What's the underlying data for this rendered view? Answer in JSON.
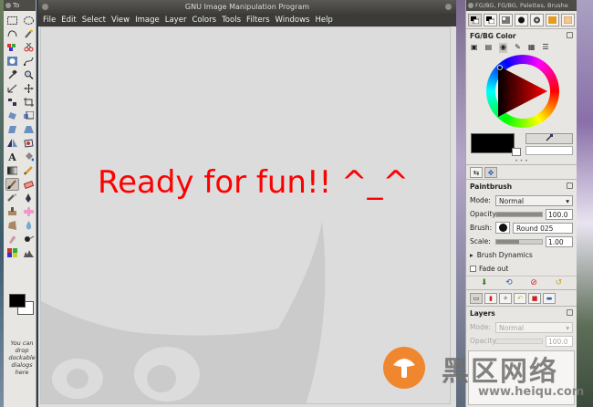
{
  "toolbox": {
    "title": "To",
    "drop_hint": "You can drop dockable dialogs here"
  },
  "main_window": {
    "title": "GNU Image Manipulation Program",
    "menu": [
      "File",
      "Edit",
      "Select",
      "View",
      "Image",
      "Layer",
      "Colors",
      "Tools",
      "Filters",
      "Windows",
      "Help"
    ],
    "canvas_text": "Ready for fun!! ^_^",
    "canvas_text_color": "#ff0000"
  },
  "dock": {
    "title": "FG/BG, FG/BG, Palettes, Brushe",
    "fgbg": {
      "title": "FG/BG Color",
      "fg_color": "#000000",
      "bg_color": "#ffffff"
    },
    "paintbrush": {
      "title": "Paintbrush",
      "mode_label": "Mode:",
      "mode_value": "Normal",
      "opacity_label": "Opacity:",
      "opacity_value": "100.0",
      "opacity_fraction": 1.0,
      "brush_label": "Brush:",
      "brush_value": "Round 025",
      "scale_label": "Scale:",
      "scale_value": "1.00",
      "scale_fraction": 0.5,
      "dynamics_label": "Brush Dynamics",
      "fade_label": "Fade out"
    },
    "layers": {
      "title": "Layers",
      "mode_label": "Mode:",
      "mode_value": "Normal",
      "opacity_label": "Opacity:",
      "opacity_value": "100.0"
    }
  },
  "watermark": {
    "cn_text": "黑区网络",
    "url": "www.heiqu.com"
  }
}
